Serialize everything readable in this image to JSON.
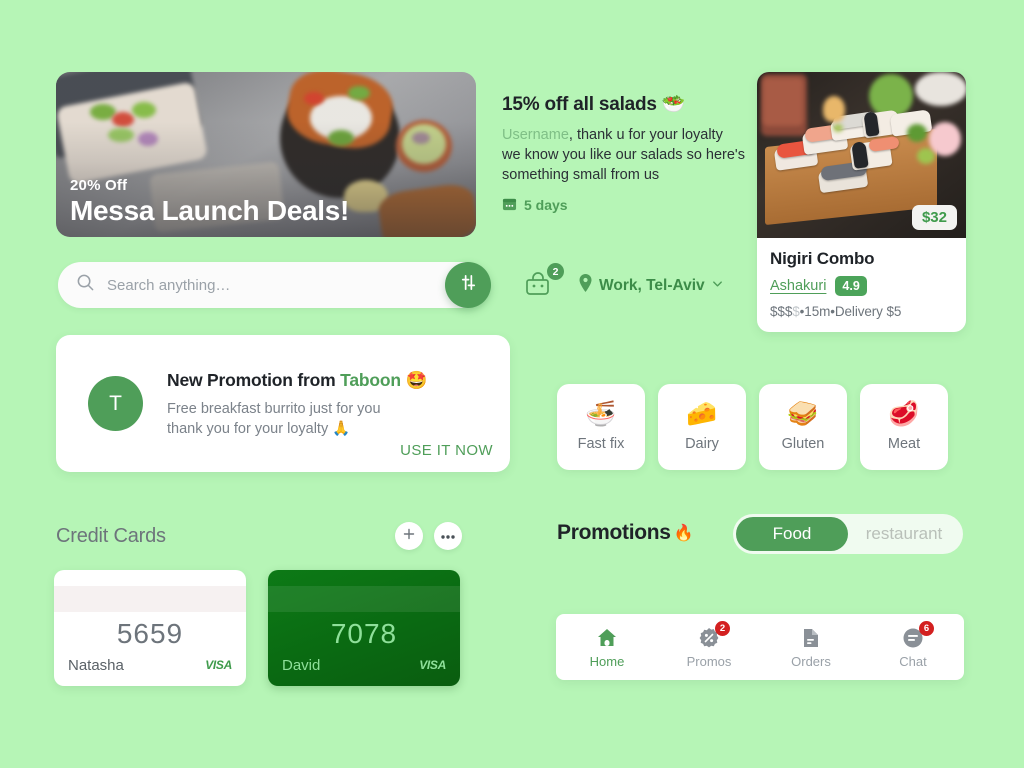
{
  "theme": {
    "bg": "#b6f5b6",
    "accent": "#4f9e59",
    "accent_dark": "#0a6a12",
    "badge_red": "#d32020"
  },
  "hero": {
    "kicker": "20% Off",
    "title": "Messa Launch Deals!"
  },
  "salad_promo": {
    "title": "15% off all salads 🥗",
    "username": "Username",
    "body_rest": ", thank u for your loyalty",
    "line2": "we know you like our salads so here's",
    "line3": "something small from us",
    "calendar_icon": "calendar-icon",
    "duration": "5 days"
  },
  "dish_card": {
    "price": "$32",
    "name": "Nigiri Combo",
    "restaurant": "Ashakuri",
    "rating": "4.9",
    "price_level": "$$$",
    "price_level_dim": "$",
    "time": "15m",
    "delivery": "Delivery $5",
    "meta": "•15m•Delivery $5"
  },
  "search": {
    "placeholder": "Search anything…",
    "value": "",
    "icon": "search-icon",
    "filter_icon": "sliders-icon"
  },
  "bag": {
    "icon": "shopping-bag-icon",
    "count": "2"
  },
  "location": {
    "icon": "map-pin-icon",
    "label": "Work, Tel-Aviv",
    "chevron": "chevron-down-icon"
  },
  "promotion_card": {
    "avatar_initial": "T",
    "title_prefix": "New Promotion from ",
    "brand": "Taboon",
    "title_emoji": " 🤩",
    "sub_line1": "Free breakfast burrito just for you",
    "sub_line2": "thank you for your loyalty 🙏",
    "cta": "USE IT NOW"
  },
  "categories": [
    {
      "emoji": "🍜",
      "label": "Fast fix",
      "icon": "takeout-box-icon"
    },
    {
      "emoji": "🧀",
      "label": "Dairy",
      "icon": "cheese-icon"
    },
    {
      "emoji": "🥪",
      "label": "Gluten",
      "icon": "sandwich-icon"
    },
    {
      "emoji": "🥩",
      "label": "Meat",
      "icon": "steak-icon"
    }
  ],
  "credit_cards": {
    "heading": "Credit Cards",
    "add_icon": "plus-icon",
    "more_icon": "ellipsis-icon",
    "items": [
      {
        "number": "5659",
        "holder": "Natasha",
        "brand": "VISA",
        "style": "white"
      },
      {
        "number": "7078",
        "holder": "David",
        "brand": "VISA",
        "style": "green"
      }
    ]
  },
  "promotions": {
    "heading": "Promotions",
    "heading_emoji": "🔥",
    "segments": [
      {
        "label": "Food",
        "active": true
      },
      {
        "label": "restaurant",
        "active": false
      }
    ]
  },
  "bottom_nav": [
    {
      "label": "Home",
      "icon": "home-icon",
      "active": true,
      "badge": ""
    },
    {
      "label": "Promos",
      "icon": "discount-gear-icon",
      "active": false,
      "badge": "2"
    },
    {
      "label": "Orders",
      "icon": "document-icon",
      "active": false,
      "badge": ""
    },
    {
      "label": "Chat",
      "icon": "chat-icon",
      "active": false,
      "badge": "6"
    }
  ]
}
